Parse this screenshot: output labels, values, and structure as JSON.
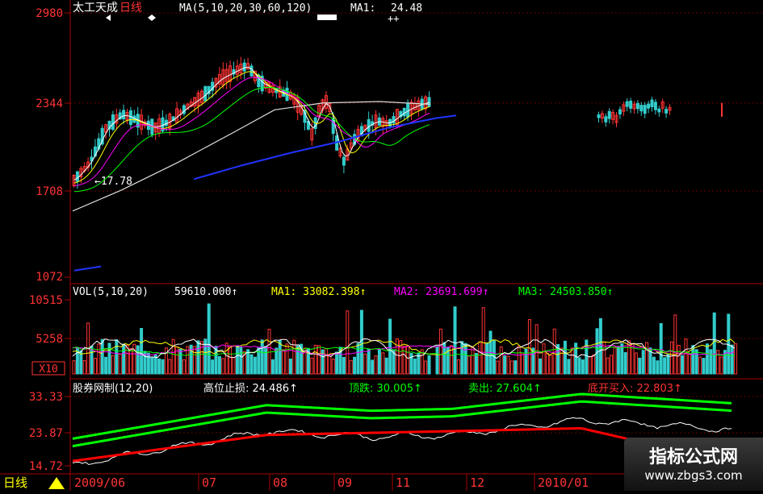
{
  "colors": {
    "background": "#000000",
    "axis": "#aa0000",
    "axis_text": "#ff3333",
    "up": "#ff3333",
    "down": "#33cccc",
    "ma5": "#ffffff",
    "ma10": "#ffff00",
    "ma20": "#ff00ff",
    "ma30": "#00ff00",
    "ma60": "#dddddd",
    "ma120": "#2233ff",
    "green_band": "#00ff00",
    "red_line": "#ff0000"
  },
  "price_panel": {
    "stock_name": "太工天成",
    "period": "日线",
    "ma_legend": "MA(5,10,20,30,60,120)",
    "ma1_label": "MA1:",
    "ma1_value": "24.48",
    "annotation": "←17.78",
    "y_ticks": [
      "2980",
      "2344",
      "1708",
      "1072"
    ]
  },
  "vol_panel": {
    "label": "VOL(5,10,20)",
    "value": "59610.000↑",
    "ma1": "MA1: 33082.398↑",
    "ma2": "MA2: 23691.699↑",
    "ma3": "MA3: 24503.850↑",
    "y_ticks": [
      "10515",
      "5258",
      "X10"
    ]
  },
  "ind_panel": {
    "label": "股券网制(12,20)",
    "item1": "高位止损: 24.486↑",
    "item2": "顶跌: 30.005↑",
    "item3": "卖出: 27.604↑",
    "item4": "底开买入: 22.803↑",
    "y_ticks": [
      "33.33",
      "23.87",
      "14.72"
    ]
  },
  "time_axis": {
    "period": "日线",
    "labels": [
      "2009/06",
      "07",
      "08",
      "09",
      "11",
      "12",
      "2010/01"
    ]
  },
  "watermark": {
    "title": "指标公式网",
    "url": "www.zbgs3.com"
  },
  "chart_data": [
    {
      "type": "candlestick",
      "title": "太工天成 日线",
      "ylim": [
        1072,
        2980
      ],
      "y_ticks": [
        2980,
        2344,
        1708,
        1072
      ],
      "series": [
        {
          "name": "MA5"
        },
        {
          "name": "MA10"
        },
        {
          "name": "MA20"
        },
        {
          "name": "MA30"
        },
        {
          "name": "MA60"
        },
        {
          "name": "MA120"
        }
      ],
      "annotations": [
        {
          "text": "←17.78"
        }
      ]
    },
    {
      "type": "bar",
      "title": "VOL(5,10,20)",
      "ylim": [
        0,
        10515
      ],
      "y_ticks": [
        10515,
        5258
      ],
      "series": [
        {
          "name": "MA1",
          "value": 33082.398
        },
        {
          "name": "MA2",
          "value": 23691.699
        },
        {
          "name": "MA3",
          "value": 24503.85
        }
      ],
      "last_volume": 59610.0
    },
    {
      "type": "line",
      "title": "股券网制(12,20)",
      "ylim": [
        14.72,
        33.33
      ],
      "y_ticks": [
        33.33,
        23.87,
        14.72
      ],
      "series": [
        {
          "name": "高位止损",
          "value": 24.486
        },
        {
          "name": "顶跌",
          "value": 30.005
        },
        {
          "name": "卖出",
          "value": 27.604
        },
        {
          "name": "底开买入",
          "value": 22.803
        }
      ]
    }
  ]
}
